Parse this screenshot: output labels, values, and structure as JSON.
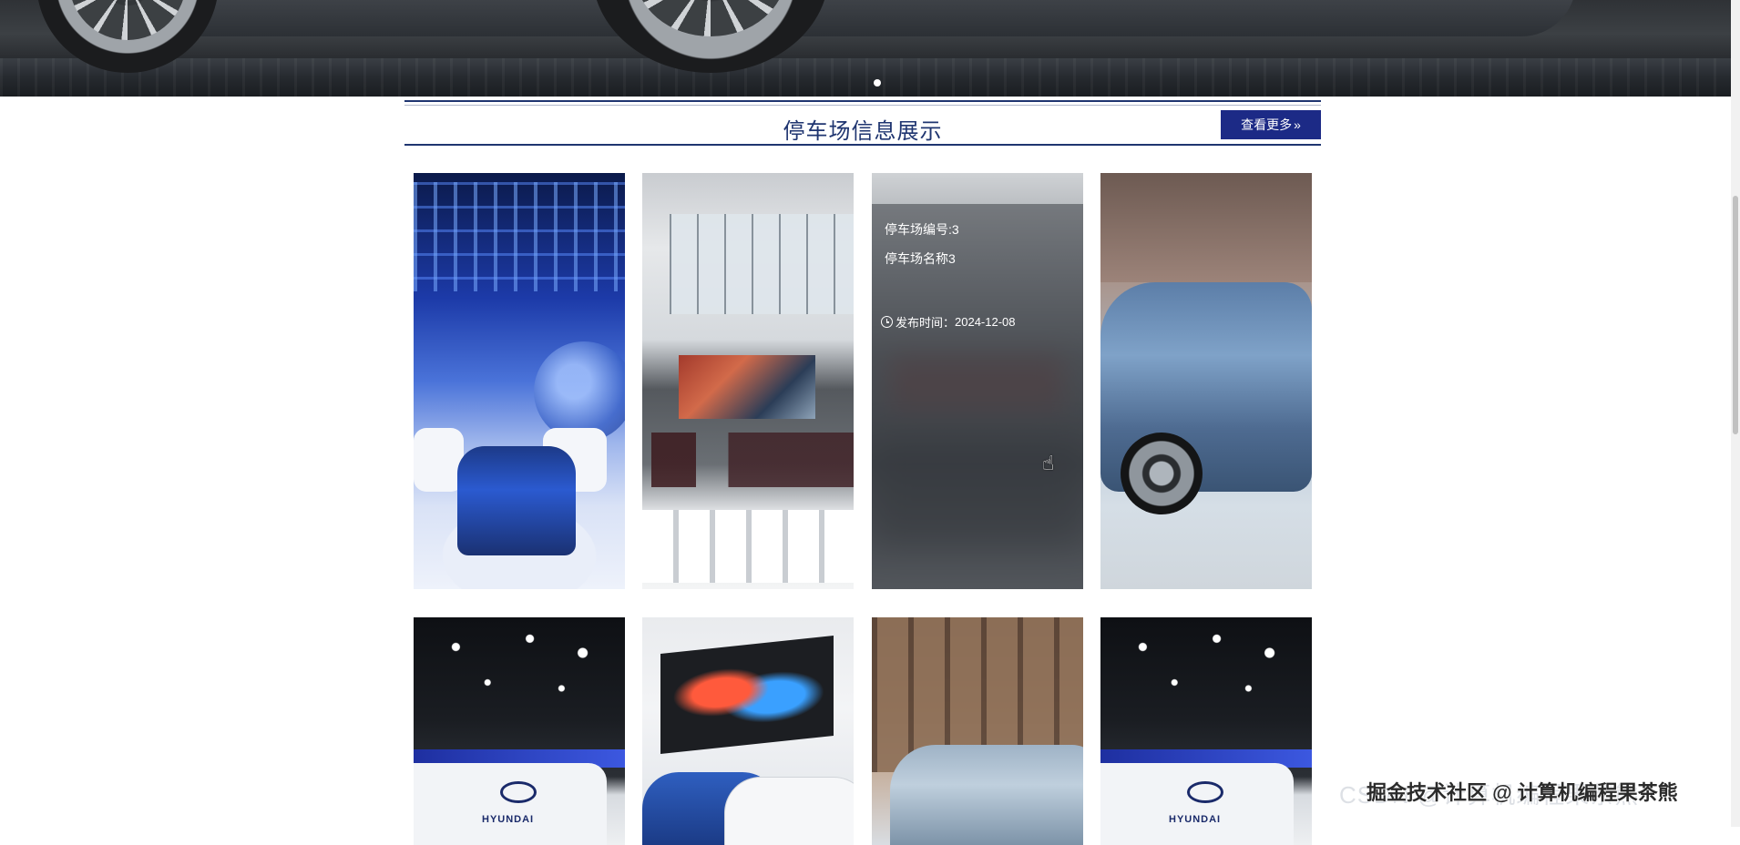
{
  "hero": {
    "slide_indicator": "carousel-dot",
    "slide_count": 1,
    "active_slide": 1
  },
  "section": {
    "title": "停车场信息展示",
    "more_label": "查看更多",
    "more_icon": "double-chevron-right-icon"
  },
  "cards": [
    {
      "image": "blue-bmw-stage",
      "hovered": false
    },
    {
      "image": "showroom-building",
      "hovered": false
    },
    {
      "image": "hall-interior",
      "hovered": true,
      "number_label": "停车场编号:3",
      "name_label": "停车场名称3",
      "time_label": "发布时间：",
      "time_value": "2024-12-08"
    },
    {
      "image": "blue-suv",
      "hovered": false
    },
    {
      "image": "hyundai-stand",
      "hovered": false,
      "brand_text": "HYUNDAI"
    },
    {
      "image": "light-screen-showroom",
      "hovered": false
    },
    {
      "image": "suv-street",
      "hovered": false
    },
    {
      "image": "hyundai-stand",
      "hovered": false,
      "brand_text": "HYUNDAI"
    }
  ],
  "watermark": {
    "text": "掘金技术社区 @ 计算机编程果茶熊",
    "faded_text": "CSDN @计算机编程果茶熊"
  },
  "colors": {
    "accent": "#1c2a86",
    "title": "#1f3570"
  }
}
